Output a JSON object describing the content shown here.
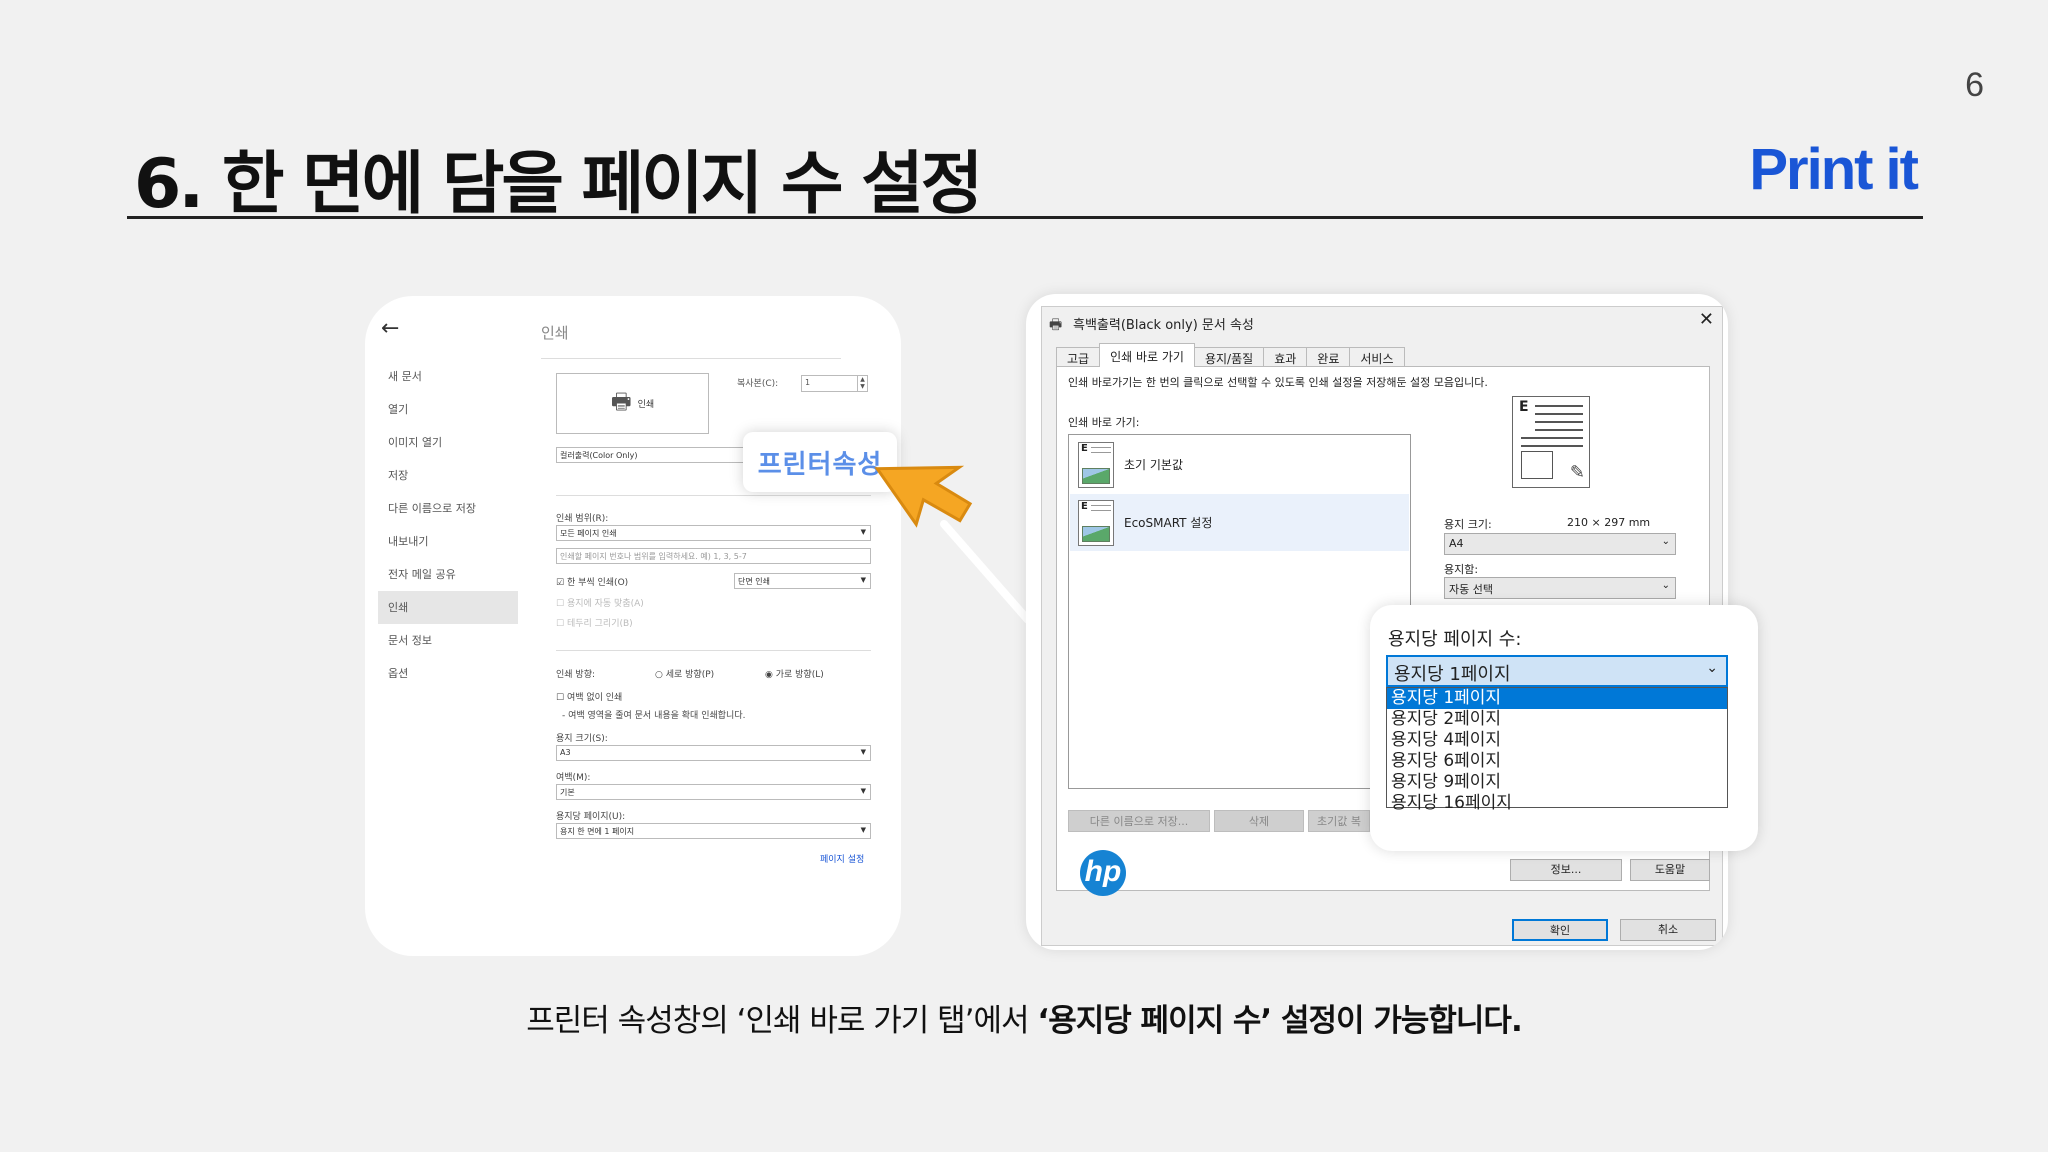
{
  "page_number": "6",
  "title": "6. 한 면에 담을 페이지 수 설정",
  "brand": "Print it",
  "print_panel": {
    "menu": [
      "새 문서",
      "열기",
      "이미지 열기",
      "저장",
      "다른 이름으로 저장",
      "내보내기",
      "전자 메일 공유",
      "인쇄",
      "문서 정보",
      "옵션"
    ],
    "active_menu": "인쇄",
    "heading": "인쇄",
    "print_button": "인쇄",
    "copies_label": "복사본(C):",
    "copies_value": "1",
    "printer_select": "컬러출력(Color Only)",
    "range_label": "인쇄 범위(R):",
    "range_value": "모든 페이지 인쇄",
    "range_placeholder": "인쇄할 페이지 번호나 범위를 입력하세요. 예) 1, 3, 5-7",
    "collate": "한 부씩 인쇄(O)",
    "duplex_value": "단면 인쇄",
    "auto_fit": "용지에 자동 맞춤(A)",
    "border": "테두리 그리기(B)",
    "orientation_label": "인쇄 방향:",
    "portrait": "세로 방향(P)",
    "landscape": "가로 방향(L)",
    "no_margin": "여백 없이 인쇄",
    "no_margin_note": "- 여백 영역을 줄여 문서 내용을 확대 인쇄합니다.",
    "paper_size_label": "용지 크기(S):",
    "paper_size_value": "A3",
    "margin_label": "여백(M):",
    "margin_value": "기본",
    "pages_per_sheet_label": "용지당 페이지(U):",
    "pages_per_sheet_value": "용지 한 면에 1 페이지",
    "page_setup_link": "페이지 설정"
  },
  "callout": "프린터속성",
  "dialog": {
    "title": "흑백출력(Black only) 문서 속성",
    "tabs": [
      "고급",
      "인쇄 바로 가기",
      "용지/품질",
      "효과",
      "완료",
      "서비스"
    ],
    "active_tab": "인쇄 바로 가기",
    "description": "인쇄 바로가기는 한 번의 클릭으로 선택할 수 있도록 인쇄 설정을 저장해둔 설정 모음입니다.",
    "shortcuts_label": "인쇄 바로 가기:",
    "shortcuts": [
      "초기 기본값",
      "EcoSMART 설정"
    ],
    "save_as_button": "다른 이름으로 저장...",
    "delete_button": "삭제",
    "reset_button": "초기값 복",
    "paper_size_label": "용지 크기:",
    "paper_size_dims": "210 × 297 mm",
    "paper_size_value": "A4",
    "paper_source_label": "용지함:",
    "paper_source_value": "자동 선택",
    "info_button": "정보...",
    "help_button": "도움말",
    "ok_button": "확인",
    "cancel_button": "취소"
  },
  "zoom": {
    "label": "용지당 페이지 수:",
    "selected": "용지당 1페이지",
    "options": [
      "용지당 1페이지",
      "용지당 2페이지",
      "용지당 4페이지",
      "용지당 6페이지",
      "용지당 9페이지",
      "용지당 16페이지"
    ]
  },
  "caption": {
    "part1": "프린터 속성창의 ‘인쇄 바로 가기 탭’에서 ",
    "part2": "‘용지당 페이지 수’ 설정이 가능합니다."
  },
  "colors": {
    "brand": "#1a56d6",
    "selection": "#0078d7",
    "callout_text": "#5b8fe8",
    "cursor": "#f5a623"
  }
}
